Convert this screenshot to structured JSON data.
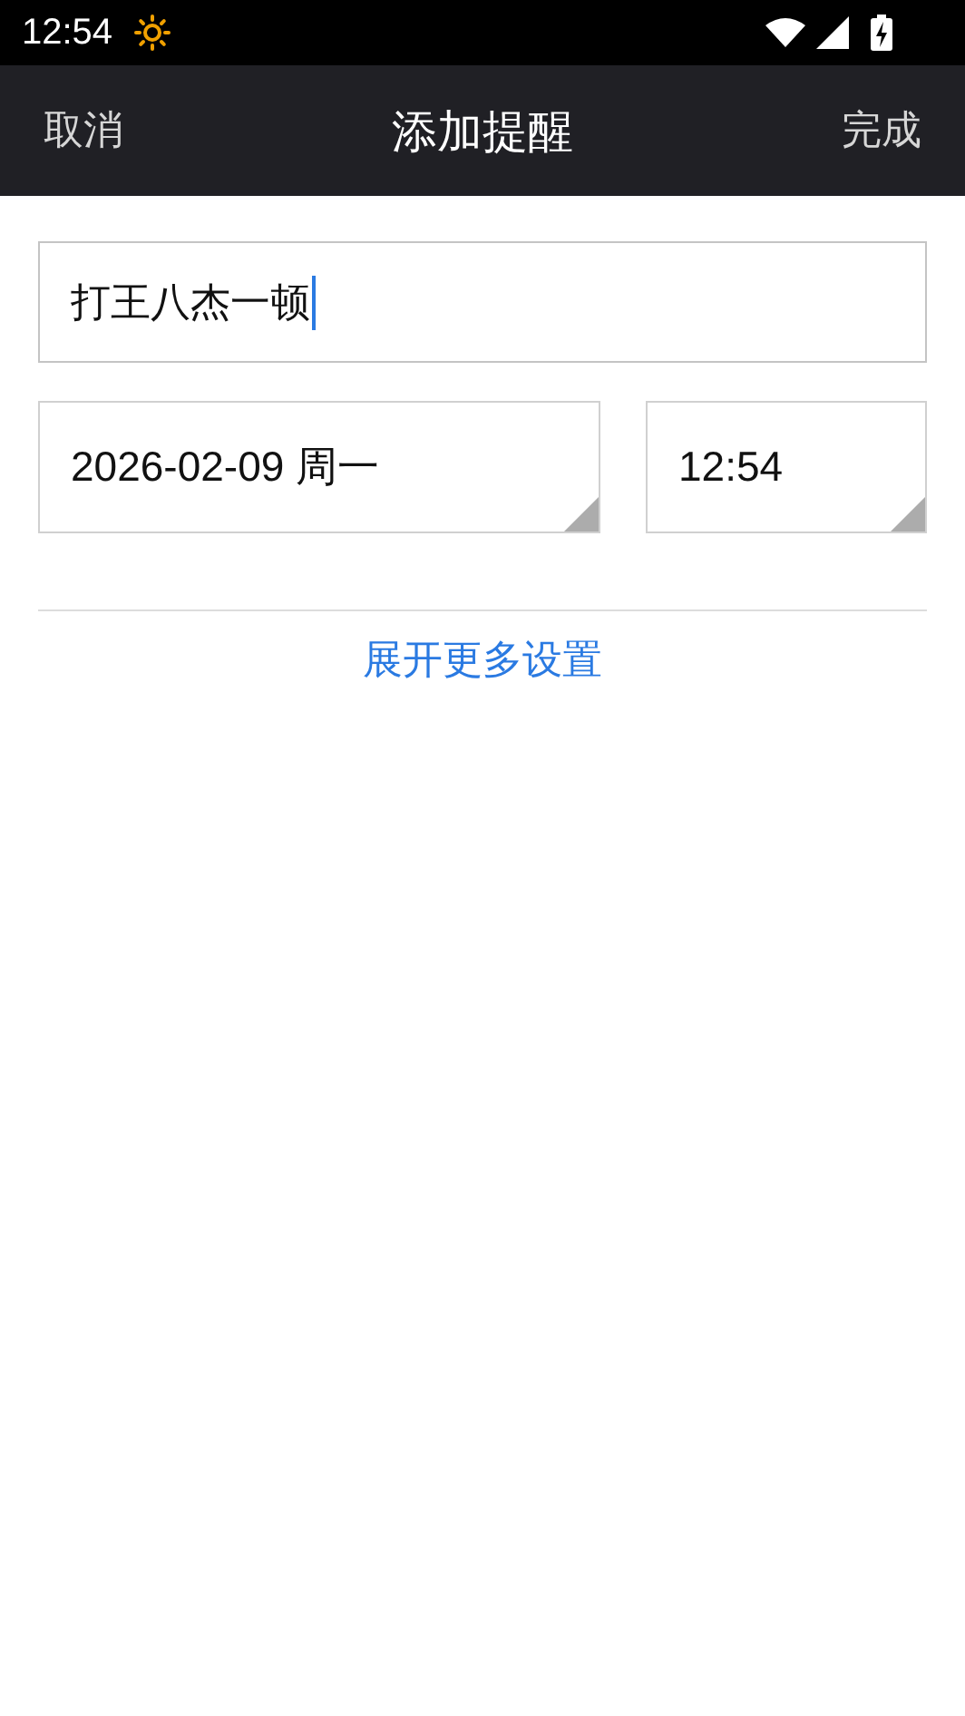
{
  "status_bar": {
    "time": "12:54"
  },
  "toolbar": {
    "cancel": "取消",
    "title": "添加提醒",
    "done": "完成"
  },
  "title_field": {
    "value": "打王八杰一顿",
    "focused": true
  },
  "date_field": {
    "value": "2026-02-09 周一"
  },
  "time_field": {
    "value": "12:54"
  },
  "more_settings": "展开更多设置"
}
